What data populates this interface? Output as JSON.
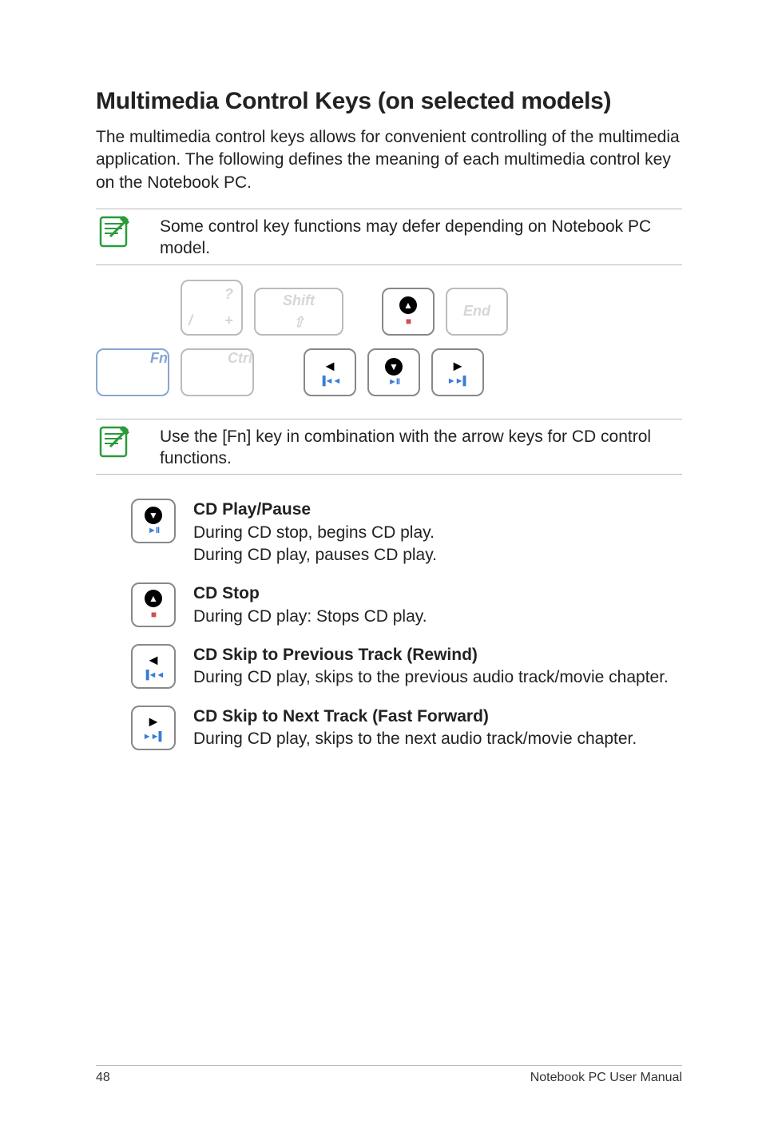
{
  "heading": "Multimedia Control Keys (on selected models)",
  "intro": "The multimedia control keys allows for convenient controlling of the multimedia application. The following defines the meaning of each multimedia control key on the Notebook PC.",
  "note1": "Some control key functions may defer depending on Notebook PC model.",
  "note2": "Use the [Fn] key in combination with the arrow keys for CD control functions.",
  "keys": {
    "slash_top": "?",
    "slash_bottom": "/",
    "slash_plus": "+",
    "shift": "Shift",
    "end": "End",
    "fn": "Fn",
    "ctrl": "Ctrl"
  },
  "media_sub": {
    "stop": "■",
    "prev": "▐◄◄",
    "play": "►II",
    "next": "►►▌"
  },
  "defs": {
    "play_title": "CD Play/Pause",
    "play_l1": "During CD stop, begins CD play.",
    "play_l2": "During CD play, pauses CD play.",
    "stop_title": "CD Stop",
    "stop_l1": "During CD play: Stops CD play.",
    "prev_title": "CD Skip to Previous Track (Rewind)",
    "prev_l1": "During CD play, skips to the previous audio track/movie chapter.",
    "next_title": "CD Skip to Next Track (Fast Forward)",
    "next_l1": "During CD play, skips to the next audio track/movie chapter."
  },
  "footer": {
    "page": "48",
    "doc": "Notebook PC User Manual"
  }
}
